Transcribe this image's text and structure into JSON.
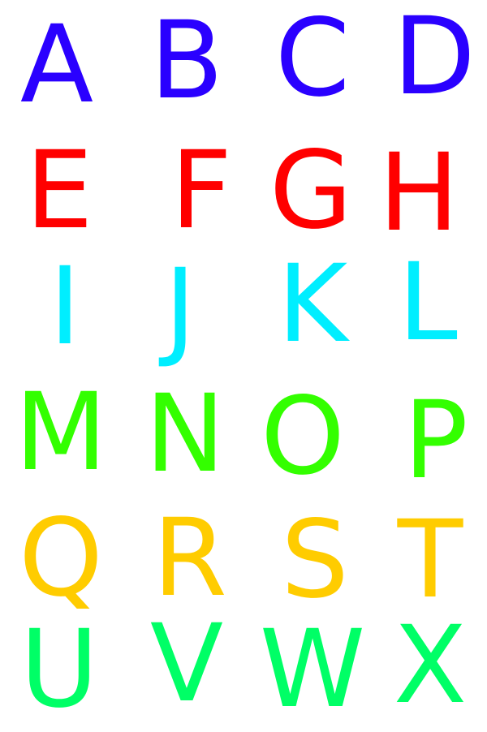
{
  "rows": [
    {
      "color": "#2a00ff",
      "letters": [
        "A",
        "B",
        "C",
        "D"
      ]
    },
    {
      "color": "#ff0000",
      "letters": [
        "E",
        "F",
        "G",
        "H"
      ]
    },
    {
      "color": "#00eeff",
      "letters": [
        "I",
        "J",
        "K",
        "L"
      ]
    },
    {
      "color": "#33ff00",
      "letters": [
        "M",
        "N",
        "O",
        "P"
      ]
    },
    {
      "color": "#ffcc00",
      "letters": [
        "Q",
        "R",
        "S",
        "T"
      ]
    },
    {
      "color": "#00ff66",
      "letters": [
        "U",
        "V",
        "W",
        "X"
      ]
    }
  ]
}
